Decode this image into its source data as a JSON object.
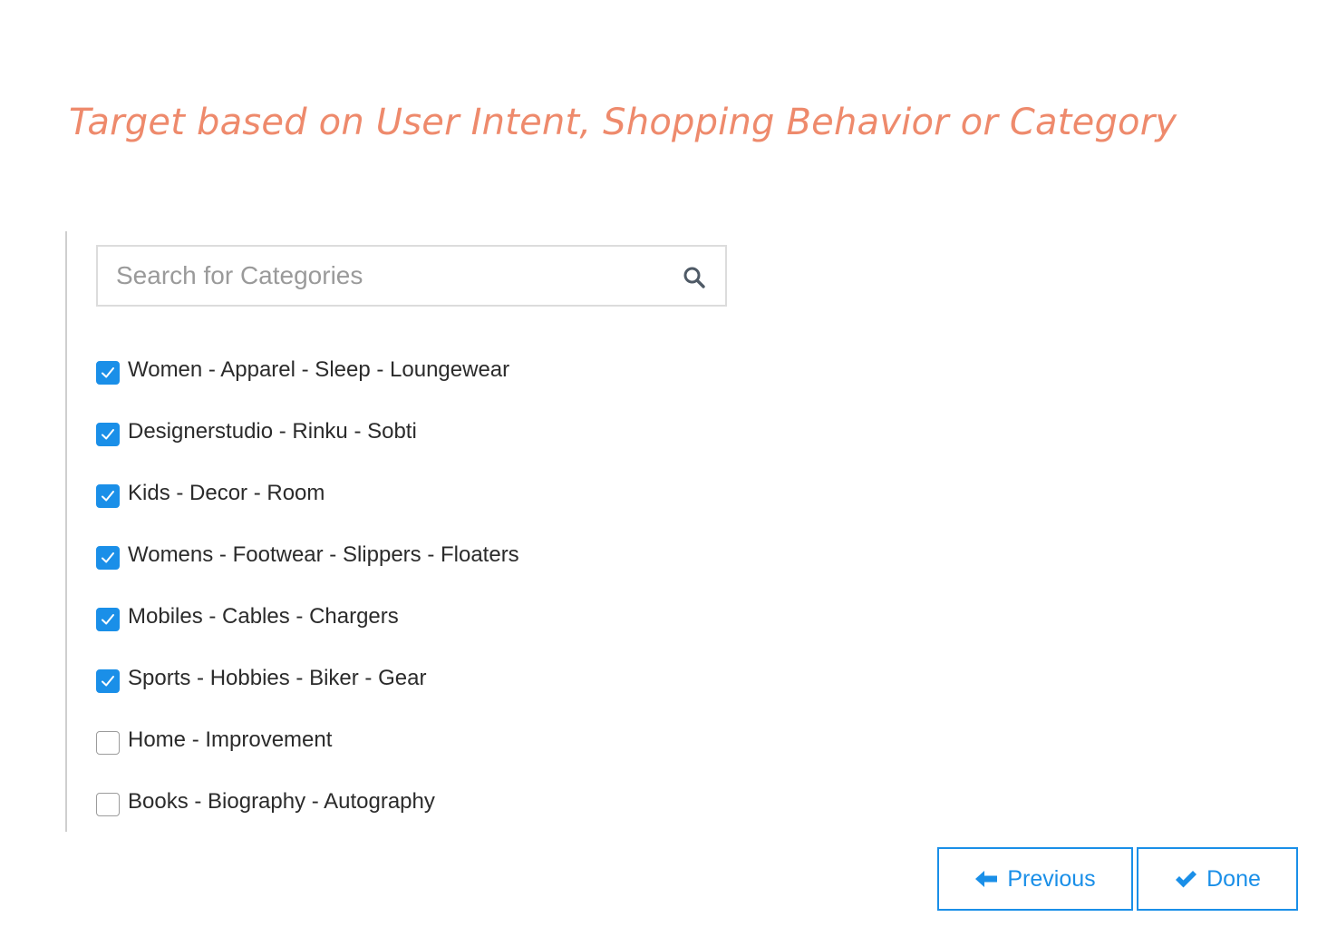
{
  "header": {
    "title": "Target based on User Intent, Shopping Behavior or Category"
  },
  "search": {
    "placeholder": "Search for Categories",
    "value": "",
    "icon": "search-icon"
  },
  "categories": [
    {
      "label": "Women - Apparel - Sleep - Loungewear",
      "checked": true
    },
    {
      "label": "Designerstudio - Rinku - Sobti",
      "checked": true
    },
    {
      "label": "Kids - Decor - Room",
      "checked": true
    },
    {
      "label": "Womens - Footwear - Slippers - Floaters",
      "checked": true
    },
    {
      "label": "Mobiles - Cables - Chargers",
      "checked": true
    },
    {
      "label": "Sports - Hobbies - Biker - Gear",
      "checked": true
    },
    {
      "label": "Home - Improvement",
      "checked": false
    },
    {
      "label": "Books - Biography - Autography",
      "checked": false
    }
  ],
  "buttons": {
    "previous_label": "Previous",
    "previous_icon": "arrow-left-icon",
    "done_label": "Done",
    "done_icon": "checkmark-icon"
  },
  "colors": {
    "title": "#ee8a6c",
    "accent": "#1a8fe8"
  }
}
